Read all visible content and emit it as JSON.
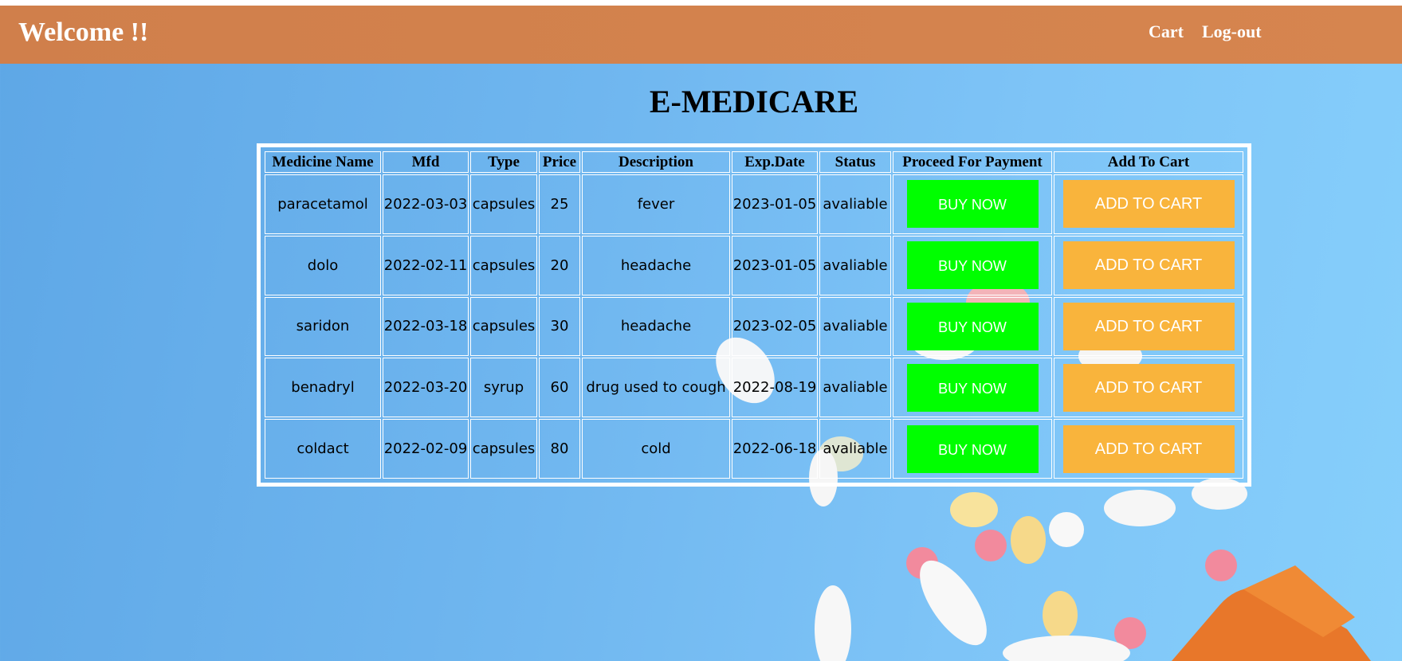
{
  "header": {
    "welcome": "Welcome !!",
    "nav": {
      "cart": "Cart",
      "logout": "Log-out"
    }
  },
  "title": "E-MEDICARE",
  "table": {
    "headers": [
      "Medicine Name",
      "Mfd",
      "Type",
      "Price",
      "Description",
      "Exp.Date",
      "Status",
      "Proceed For Payment",
      "Add To Cart"
    ],
    "rows": [
      {
        "name": "paracetamol",
        "mfd": "2022-03-03",
        "type": "capsules",
        "price": "25",
        "description": "fever",
        "exp": "2023-01-05",
        "status": "avaliable",
        "buy": "BUY NOW",
        "add": "ADD TO CART"
      },
      {
        "name": "dolo",
        "mfd": "2022-02-11",
        "type": "capsules",
        "price": "20",
        "description": "headache",
        "exp": "2023-01-05",
        "status": "avaliable",
        "buy": "BUY NOW",
        "add": "ADD TO CART"
      },
      {
        "name": "saridon",
        "mfd": "2022-03-18",
        "type": "capsules",
        "price": "30",
        "description": "headache",
        "exp": "2023-02-05",
        "status": "avaliable",
        "buy": "BUY NOW",
        "add": "ADD TO CART"
      },
      {
        "name": "benadryl",
        "mfd": "2022-03-20",
        "type": "syrup",
        "price": "60",
        "description": "drug used to cough",
        "exp": "2022-08-19",
        "status": "avaliable",
        "buy": "BUY NOW",
        "add": "ADD TO CART"
      },
      {
        "name": "coldact",
        "mfd": "2022-02-09",
        "type": "capsules",
        "price": "80",
        "description": "cold",
        "exp": "2022-06-18",
        "status": "avaliable",
        "buy": "BUY NOW",
        "add": "ADD TO CART"
      }
    ]
  },
  "colors": {
    "navbar": "#d6854f",
    "buy_button": "#00ff00",
    "cart_button": "#f9b43c",
    "background": "#7ec4f7"
  }
}
